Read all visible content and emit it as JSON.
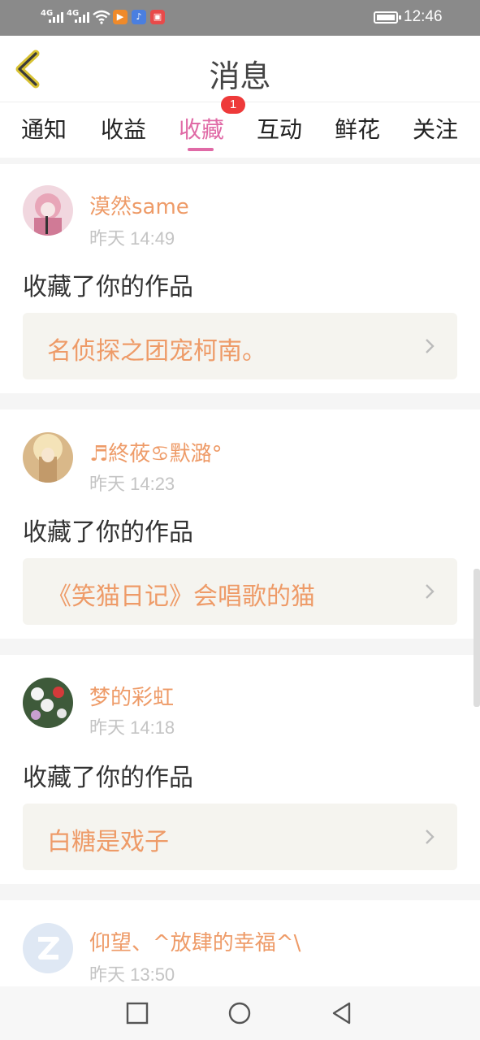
{
  "status_bar": {
    "signal1": "4G",
    "signal2": "4G",
    "time": "12:46",
    "app_icons": [
      "video-app-icon",
      "music-app-icon",
      "shop-app-icon"
    ]
  },
  "header": {
    "title": "消息",
    "back_icon": "chevron-left-icon"
  },
  "tabs": [
    {
      "label": "通知"
    },
    {
      "label": "收益"
    },
    {
      "label": "收藏",
      "active": true,
      "badge": "1"
    },
    {
      "label": "互动"
    },
    {
      "label": "鲜花"
    },
    {
      "label": "关注"
    }
  ],
  "messages": [
    {
      "username": "漠然same",
      "time": "昨天 14:49",
      "action": "收藏了你的作品",
      "work": "名侦探之团宠柯南。"
    },
    {
      "username": "♬終莜♋默潞°",
      "time": "昨天 14:23",
      "action": "收藏了你的作品",
      "work": "《笑猫日记》会唱歌的猫"
    },
    {
      "username": "梦的彩虹",
      "time": "昨天 14:18",
      "action": "收藏了你的作品",
      "work": "白糖是戏子"
    },
    {
      "username": "仰望、^放肆的幸福^\\",
      "time": "昨天 13:50"
    }
  ],
  "colors": {
    "accent": "#e06aa6",
    "name": "#ee9b68",
    "badge": "#ee3a3a"
  },
  "nav_icons": [
    "square-recents-icon",
    "circle-home-icon",
    "triangle-back-icon"
  ]
}
